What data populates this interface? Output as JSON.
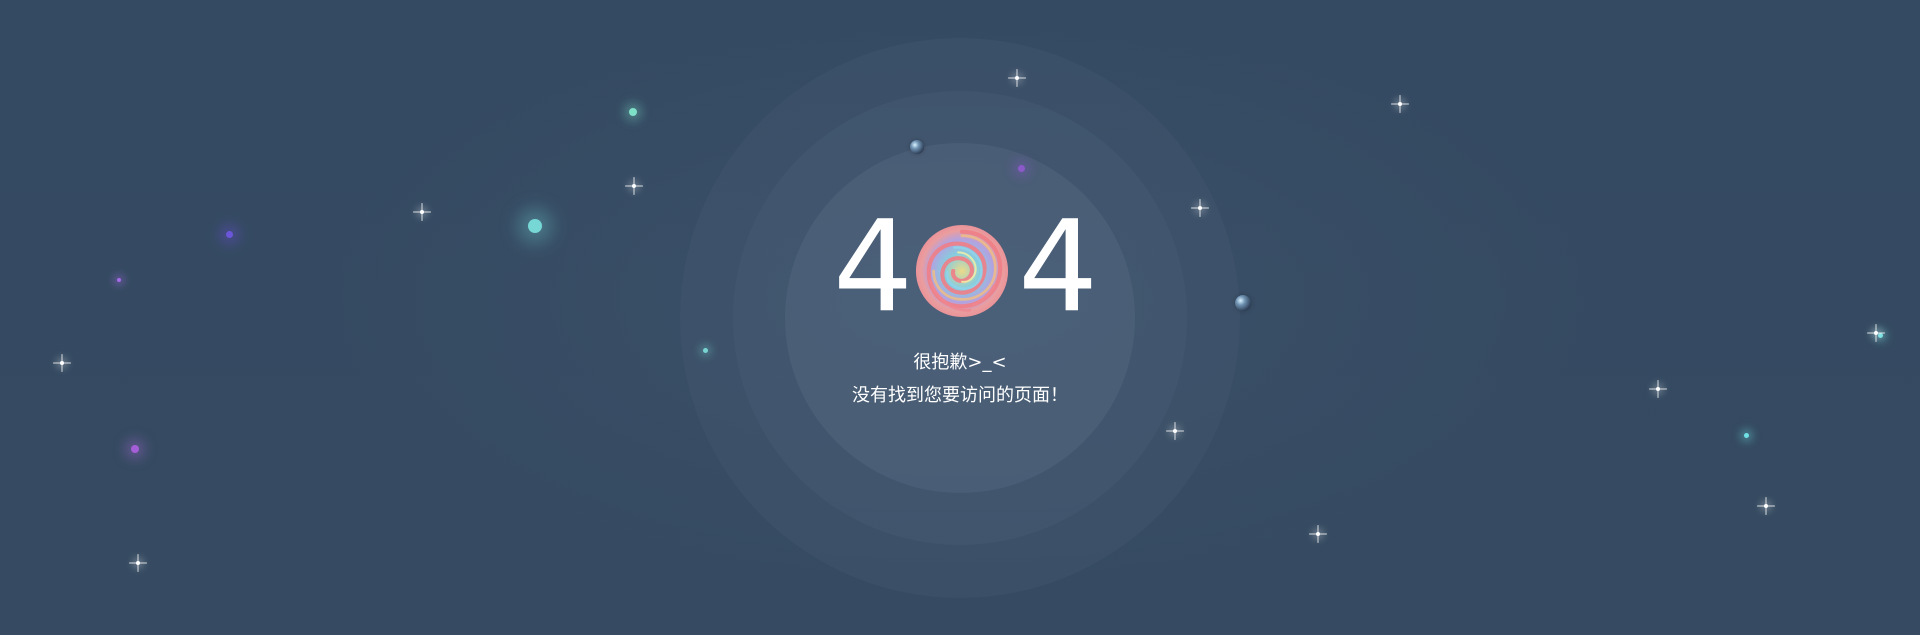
{
  "error": {
    "code_left": "4",
    "code_right": "4",
    "line1": "很抱歉>_<",
    "line2": "没有找到您要访问的页面！"
  },
  "colors": {
    "background": "#354a61",
    "text": "#ffffff",
    "ring": "#5b718a"
  },
  "icons": {
    "swirl": "swirl-planet-icon",
    "sparkle": "sparkle-star-icon",
    "planet": "small-planet-icon"
  }
}
